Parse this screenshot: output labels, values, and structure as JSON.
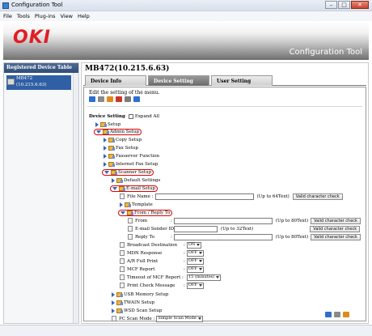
{
  "window": {
    "title": "Configuration Tool",
    "controls": [
      "–",
      "□",
      "✕"
    ]
  },
  "menu": [
    "File",
    "Tools",
    "Plug-ins",
    "View",
    "Help"
  ],
  "banner": {
    "logo": "OKI",
    "app_title": "Configuration Tool"
  },
  "left_panel": {
    "header": "Registered Device Table",
    "device": {
      "name": "MB472",
      "ip": "(10.215.6.63)"
    }
  },
  "device_title": "MB472(10.215.6.63)",
  "tabs": [
    "Device Info",
    "Device Setting",
    "User Setting"
  ],
  "active_tab": "Device Setting",
  "description": "Edit the setting of the menu.",
  "tree": {
    "root": "Device Setting",
    "expand_all": "Expand All",
    "setup": "Setup",
    "admin_setup": "Admin Setup",
    "copy_setup": "Copy Setup",
    "fax_setup": "Fax Setup",
    "faxserver_function": "Faxserver Function",
    "internet_fax_setup": "Internet Fax Setup",
    "scanner_setup": "Scanner Setup",
    "default_settings": "Default Settings",
    "email_setup": "E-mail Setup",
    "file_name": {
      "label": "File Name :",
      "hint": "(Up to 64Text)",
      "button": "Valid character check"
    },
    "template": "Template",
    "from_reply_to": "From / Reply To",
    "from": {
      "label": "From",
      "sep": ":",
      "hint": "(Up to 80Text)",
      "button": "Valid character check"
    },
    "sender_id": {
      "label": "E-mail Sender ID :",
      "hint": "(Up to 32Text)",
      "button": "Valid character check"
    },
    "reply_to": {
      "label": "Reply To",
      "sep": ":",
      "hint": "(Up to 80Text)",
      "button": "Valid character check"
    },
    "broadcast_destination": {
      "label": "Broadcast Destination",
      "sep": ":",
      "value": "ON"
    },
    "mdn_response": {
      "label": "MDN Response",
      "sep": ":",
      "value": "OFF"
    },
    "ar_full_print": {
      "label": "A/R Full Print",
      "sep": ":",
      "value": "OFF"
    },
    "mcf_report": {
      "label": "MCF Report",
      "sep": ":",
      "value": "OFF"
    },
    "timeout_mcf": {
      "label": "Timeout of MCF Report :",
      "value": "15 (minutes)"
    },
    "print_check_message": {
      "label": "Print Check Message",
      "sep": ":",
      "value": "OFF"
    },
    "usb_memory_setup": "USB Memory Setup",
    "twain_setup": "TWAIN Setup",
    "wsd_scan_setup": "WSD Scan Setup",
    "pc_scan_mode": {
      "label": "PC Scan Mode :",
      "value": "Simple Scan Mode"
    }
  },
  "colors": {
    "oki_red": "#e11d24",
    "highlight": "#e00000",
    "selection": "#2f5fa5"
  }
}
